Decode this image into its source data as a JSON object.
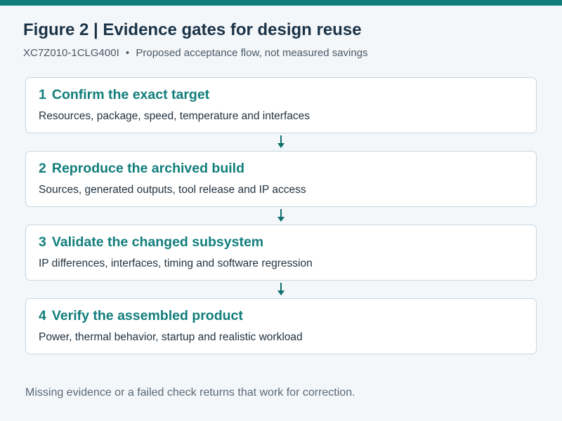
{
  "title": "Figure 2 | Evidence gates for design reuse",
  "subtitle": {
    "part_number": "XC7Z010-1CLG400I",
    "separator": "•",
    "note": "Proposed acceptance flow, not measured savings"
  },
  "stages": [
    {
      "number": "1",
      "title": "Confirm the exact target",
      "description": "Resources, package, speed, temperature and interfaces"
    },
    {
      "number": "2",
      "title": "Reproduce the archived build",
      "description": "Sources, generated outputs, tool release and IP access"
    },
    {
      "number": "3",
      "title": "Validate the changed subsystem",
      "description": "IP differences, interfaces, timing and software regression"
    },
    {
      "number": "4",
      "title": "Verify the assembled product",
      "description": "Power, thermal behavior, startup and realistic workload"
    }
  ],
  "footer": "Missing evidence or a failed check returns that work for correction.",
  "colors": {
    "accent": "#117e7c",
    "arrow": "#0e6f6c",
    "title_text": "#1b3347",
    "background": "#f3f7fa",
    "card_border": "#c9d6de"
  },
  "icons": {
    "connector": "arrow-down-icon"
  }
}
